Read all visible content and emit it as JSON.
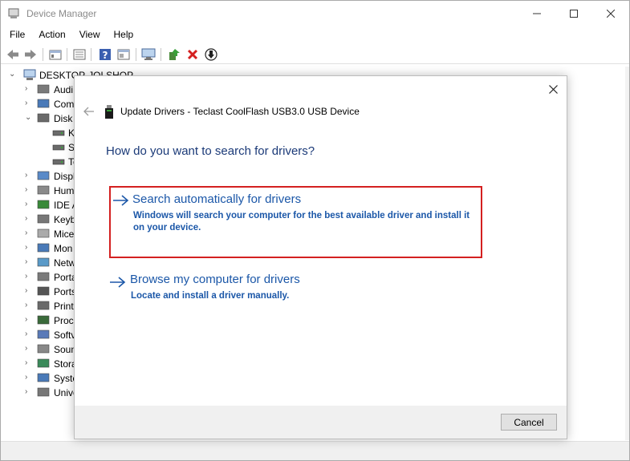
{
  "window": {
    "title": "Device Manager",
    "controls": {
      "minimize": "—",
      "maximize": "☐",
      "close": "✕"
    }
  },
  "menu": [
    "File",
    "Action",
    "View",
    "Help"
  ],
  "toolbar": {
    "buttons": [
      "back-icon",
      "forward-icon",
      "properties-icon",
      "list-icon",
      "help-icon",
      "view-icon",
      "monitor-icon",
      "update-driver-icon",
      "uninstall-icon",
      "download-icon"
    ]
  },
  "tree": {
    "root": "DESKTOP-JOLSHOP",
    "items": [
      {
        "label": "Audi",
        "icon": "speaker-icon"
      },
      {
        "label": "Com",
        "icon": "computer-icon"
      },
      {
        "label": "Disk",
        "icon": "disk-icon",
        "expanded": true,
        "children": [
          "K",
          "S",
          "Te"
        ]
      },
      {
        "label": "Displ",
        "icon": "display-icon"
      },
      {
        "label": "Hum",
        "icon": "hid-icon"
      },
      {
        "label": "IDE A",
        "icon": "ide-icon"
      },
      {
        "label": "Keyb",
        "icon": "keyboard-icon"
      },
      {
        "label": "Mice",
        "icon": "mouse-icon"
      },
      {
        "label": "Mon",
        "icon": "monitor-icon"
      },
      {
        "label": "Netw",
        "icon": "network-icon"
      },
      {
        "label": "Porta",
        "icon": "portable-icon"
      },
      {
        "label": "Ports",
        "icon": "port-icon"
      },
      {
        "label": "Print",
        "icon": "printer-icon"
      },
      {
        "label": "Proce",
        "icon": "processor-icon"
      },
      {
        "label": "Softv",
        "icon": "software-icon"
      },
      {
        "label": "Soun",
        "icon": "sound-icon"
      },
      {
        "label": "Stora",
        "icon": "storage-icon"
      },
      {
        "label": "Syste",
        "icon": "system-icon"
      },
      {
        "label": "Unive",
        "icon": "usb-icon"
      }
    ]
  },
  "dialog": {
    "title": "Update Drivers - Teclast CoolFlash USB3.0 USB Device",
    "heading": "How do you want to search for drivers?",
    "close": "✕",
    "back": "←",
    "options": [
      {
        "title": "Search automatically for drivers",
        "description": "Windows will search your computer for the best available driver and install it on your device.",
        "highlighted": true
      },
      {
        "title": "Browse my computer for drivers",
        "description": "Locate and install a driver manually.",
        "highlighted": false
      }
    ],
    "cancel_label": "Cancel"
  },
  "colors": {
    "link_blue": "#1b57a8",
    "heading_blue": "#1b3a78",
    "highlight_red": "#d42020"
  }
}
